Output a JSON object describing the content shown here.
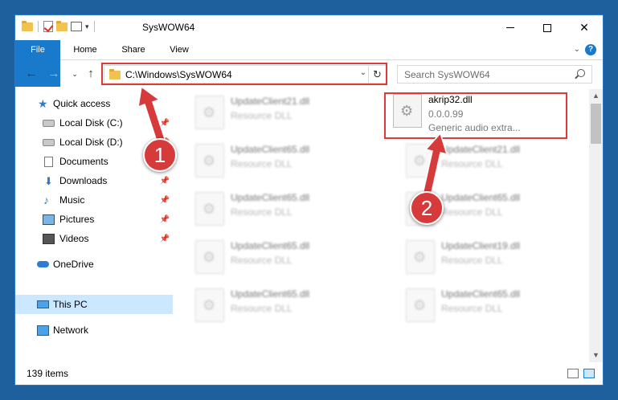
{
  "window": {
    "title": "SysWOW64"
  },
  "ribbon": {
    "tabs": [
      "File",
      "Home",
      "Share",
      "View"
    ],
    "help": "?"
  },
  "nav": {
    "address": "C:\\Windows\\SysWOW64",
    "search_placeholder": "Search SysWOW64"
  },
  "sidebar": {
    "quick_access": "Quick access",
    "items": [
      "Local Disk (C:)",
      "Local Disk (D:)",
      "Documents",
      "Downloads",
      "Music",
      "Pictures",
      "Videos"
    ],
    "onedrive": "OneDrive",
    "this_pc": "This PC",
    "network": "Network"
  },
  "files": {
    "left_column": [
      {
        "name": "UpdateClient21.dll",
        "type": "Resource DLL"
      },
      {
        "name": "UpdateClient65.dll",
        "type": "Resource DLL"
      },
      {
        "name": "UpdateClient65.dll",
        "type": "Resource DLL"
      },
      {
        "name": "UpdateClient65.dll",
        "type": "Resource DLL"
      },
      {
        "name": "UpdateClient65.dll",
        "type": "Resource DLL"
      }
    ],
    "right_column": [
      {
        "name": "UpdateClient21.dll",
        "type": "Resource DLL"
      },
      {
        "name": "UpdateClient65.dll",
        "type": "Resource DLL"
      },
      {
        "name": "UpdateClient19.dll",
        "type": "Resource DLL"
      },
      {
        "name": "UpdateClient65.dll",
        "type": "Resource DLL"
      }
    ],
    "highlighted": {
      "name": "akrip32.dll",
      "version": "0.0.0.99",
      "description": "Generic audio extra..."
    }
  },
  "status": {
    "items": "139 items"
  },
  "callouts": [
    "1",
    "2"
  ],
  "colors": {
    "accent": "#1979ca",
    "annotation": "#d73a3a"
  }
}
